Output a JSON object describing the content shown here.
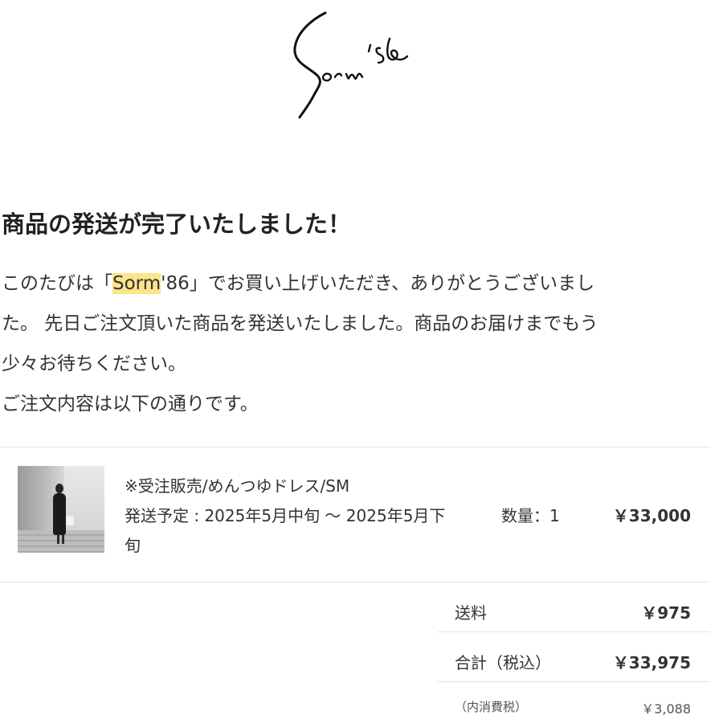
{
  "brand": {
    "logo_text": "Sorm'86"
  },
  "email": {
    "headline": "商品の発送が完了いたしました！",
    "greeting": {
      "before": "このたびは「",
      "highlight": "Sorm",
      "after": "'86」でお買い上げいただき、ありがとうございまし"
    },
    "line2": "た。 先日ご注文頂いた商品を発送いたしました。商品のお届けまでもう",
    "line3": "少々お待ちください。",
    "line4": "ご注文内容は以下の通りです。",
    "highlight_color": "#fbe58a"
  },
  "order": {
    "item": {
      "image_icon": "product-photo-icon",
      "title": "※受注販売/めんつゆドレス/SM",
      "shipping": "発送予定 : 2025年5月中旬 〜 2025年5月下旬",
      "quantity": "数量：1",
      "price": "￥33,000"
    },
    "summary": {
      "shipping_label": "送料",
      "shipping_value": "￥975",
      "total_label": "合計（税込）",
      "total_value": "￥33,975",
      "tax_label": "（内消費税）",
      "tax_value": "￥3,088"
    }
  }
}
